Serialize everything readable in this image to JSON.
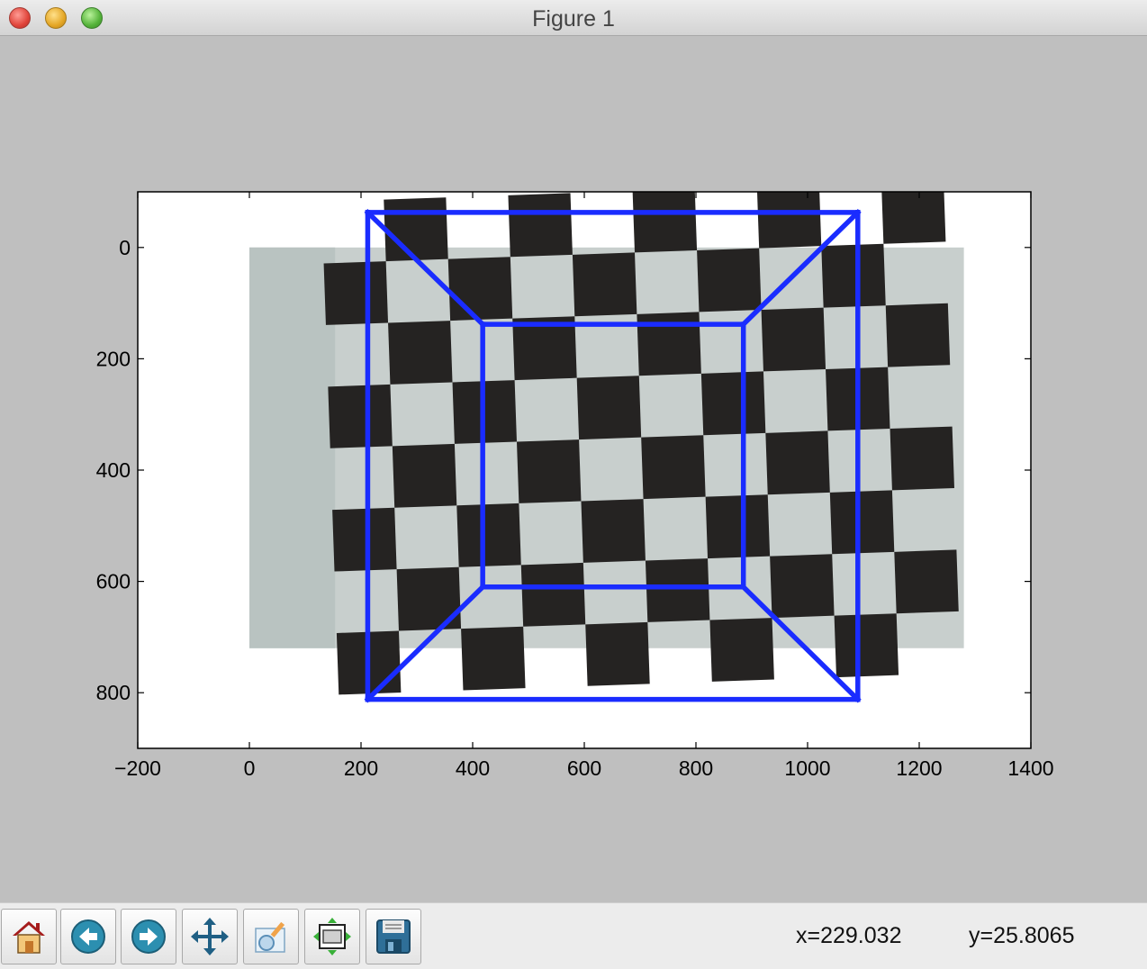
{
  "window": {
    "title": "Figure 1"
  },
  "toolbar": {
    "buttons": [
      {
        "name": "home-button",
        "icon": "home-icon"
      },
      {
        "name": "back-button",
        "icon": "back-arrow-icon"
      },
      {
        "name": "forward-button",
        "icon": "forward-arrow-icon"
      },
      {
        "name": "pan-button",
        "icon": "move-arrows-icon"
      },
      {
        "name": "zoom-button",
        "icon": "zoom-rect-icon"
      },
      {
        "name": "subplots-button",
        "icon": "subplots-icon"
      },
      {
        "name": "save-button",
        "icon": "floppy-disk-icon"
      }
    ]
  },
  "status": {
    "x_text": "x=229.032",
    "y_text": "y=25.8065"
  },
  "chart_data": {
    "type": "line",
    "title": "",
    "xlabel": "",
    "ylabel": "",
    "xlim": [
      -200,
      1400
    ],
    "ylim": [
      900,
      -100
    ],
    "y_inverted": true,
    "grid": false,
    "legend": "none",
    "xticks": [
      -200,
      0,
      200,
      400,
      600,
      800,
      1000,
      1200,
      1400
    ],
    "xtick_labels": [
      "−200",
      "0",
      "200",
      "400",
      "600",
      "800",
      "1000",
      "1200",
      "1400"
    ],
    "yticks": [
      0,
      200,
      400,
      600,
      800
    ],
    "ytick_labels": [
      "0",
      "200",
      "400",
      "600",
      "800"
    ],
    "image": {
      "content": "checkerboard photograph",
      "extent": {
        "x": [
          0,
          1280
        ],
        "y": [
          0,
          720
        ]
      }
    },
    "series": [
      {
        "color": "#1a2cff",
        "segments": [
          [
            [
              212,
              -63
            ],
            [
              1090,
              -63
            ]
          ],
          [
            [
              1090,
              -63
            ],
            [
              1090,
              812
            ]
          ],
          [
            [
              1090,
              812
            ],
            [
              212,
              812
            ]
          ],
          [
            [
              212,
              812
            ],
            [
              212,
              -63
            ]
          ],
          [
            [
              418,
              138
            ],
            [
              885,
              138
            ]
          ],
          [
            [
              885,
              138
            ],
            [
              885,
              610
            ]
          ],
          [
            [
              885,
              610
            ],
            [
              418,
              610
            ]
          ],
          [
            [
              418,
              610
            ],
            [
              418,
              138
            ]
          ],
          [
            [
              212,
              -63
            ],
            [
              418,
              138
            ]
          ],
          [
            [
              1090,
              -63
            ],
            [
              885,
              138
            ]
          ],
          [
            [
              212,
              812
            ],
            [
              418,
              610
            ]
          ],
          [
            [
              1090,
              812
            ],
            [
              885,
              610
            ]
          ]
        ]
      }
    ]
  }
}
